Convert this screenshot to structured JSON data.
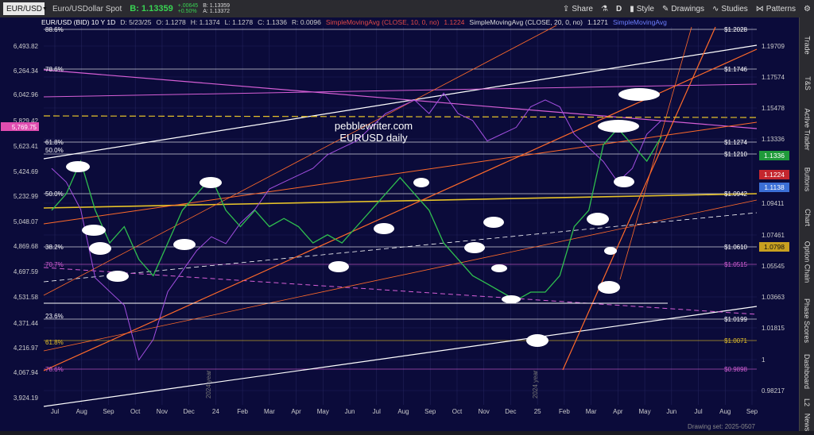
{
  "toolbar": {
    "symbol": "EUR/USD",
    "description": "Euro/USDollar Spot",
    "bid": "B: 1.13359",
    "change_pos": "+.00645",
    "change_pct": "+0.50%",
    "q_b": "B: 1.13359",
    "q_a": "A: 1.13372",
    "share": "Share",
    "style": "Style",
    "drawings": "Drawings",
    "studies": "Studies",
    "patterns": "Patterns",
    "d_label": "D"
  },
  "infobar": {
    "title": "EUR/USD (BID) 10 Y 1D",
    "date": "D: 5/23/25",
    "open": "O: 1.1278",
    "high": "H: 1.1374",
    "low": "L: 1.1278",
    "close": "C: 1.1336",
    "change": "R: 0.0096",
    "sma10": "SimpleMovingAvg (CLOSE, 10, 0, no)",
    "sma10_val": "1.1224",
    "sma20": "SimpleMovingAvg (CLOSE, 20, 0, no)",
    "sma20_val": "1.1271",
    "sma_more": "SimpleMovingAvg"
  },
  "annotations": {
    "watermark1": "pebblewriter.com",
    "watermark2": "EURUSD daily",
    "year_2024_a": "2024 year",
    "year_2024_b": "2024 year"
  },
  "colors": {
    "bg": "#0b0b3a",
    "white_line": "#ffffff",
    "magenta": "#d65fd6",
    "orange": "#ff6a2a",
    "yellow": "#e6c229",
    "green_badge": "#1f9a3a",
    "red_badge": "#c4262e",
    "blue_badge": "#3b6fd6",
    "gold_badge": "#c8a020"
  },
  "side_tabs": [
    "Trade",
    "T&S",
    "Active Trader",
    "Buttons",
    "Chart",
    "Option Chain",
    "Phase Scores",
    "Dashboard",
    "L2",
    "News"
  ],
  "footer": {
    "drawing_set": "Drawing set: 2025-0507"
  },
  "chart_data": {
    "type": "line",
    "title": "EUR/USD (BID) 10 Y 1D",
    "x_ticks": [
      "Jul",
      "Aug",
      "Sep",
      "Oct",
      "Nov",
      "Dec",
      "24",
      "Feb",
      "Mar",
      "Apr",
      "May",
      "Jun",
      "Jul",
      "Aug",
      "Sep",
      "Oct",
      "Nov",
      "Dec",
      "25",
      "Feb",
      "Mar",
      "Apr",
      "May",
      "Jun",
      "Jul",
      "Aug",
      "Sep"
    ],
    "left_axis_ticks": [
      "6,493.82",
      "6,264.34",
      "6,042.96",
      "5,829.42",
      "5,769.75",
      "5,623.41",
      "5,424.69",
      "5,232.99",
      "5,048.07",
      "4,869.68",
      "4,697.59",
      "4,531.58",
      "4,371.44",
      "4,216.97",
      "4,067.94",
      "3,924.19"
    ],
    "right_axis_ticks": [
      "1.19709",
      "1.17574",
      "1.15478",
      "1.13336",
      "1.09411",
      "1.07461",
      "1.05545",
      "1.03663",
      "1.01815",
      "1",
      "0.98217"
    ],
    "fib_labels_left": [
      "88.6%",
      "78.6%",
      "61.8%",
      "50.0%",
      "50.0%",
      "38.2%",
      "70.7%",
      "23.6%",
      "61.8%",
      "78.6%"
    ],
    "fib_labels_right": [
      "$1.2028",
      "$1.1746",
      "$1.1274",
      "$1.1210",
      "$1.0942",
      "$1.0610",
      "$1.0515",
      "$1.0199",
      "$1.0071",
      "$0.9898"
    ],
    "price_badges": [
      {
        "label": "1.1336",
        "color": "green"
      },
      {
        "label": "1.1224",
        "color": "red"
      },
      {
        "label": "1.1138",
        "color": "blue"
      },
      {
        "label": "1.0798",
        "color": "gold"
      }
    ],
    "price_path": [
      1.09,
      1.1,
      1.12,
      1.09,
      1.07,
      1.08,
      1.06,
      1.05,
      1.07,
      1.09,
      1.1,
      1.11,
      1.09,
      1.08,
      1.09,
      1.08,
      1.085,
      1.08,
      1.07,
      1.075,
      1.07,
      1.08,
      1.09,
      1.1,
      1.11,
      1.1,
      1.09,
      1.07,
      1.06,
      1.05,
      1.045,
      1.04,
      1.035,
      1.04,
      1.04,
      1.05,
      1.08,
      1.09,
      1.13,
      1.14,
      1.13,
      1.12,
      1.135
    ],
    "sp_path": [
      5600,
      5500,
      5300,
      4800,
      4700,
      4600,
      4200,
      4350,
      4700,
      4850,
      5000,
      5100,
      5050,
      5200,
      5300,
      5450,
      5500,
      5550,
      5600,
      5700,
      5750,
      5800,
      5900,
      6000,
      6050,
      6100,
      6000,
      6150,
      6000,
      5950,
      5800,
      5850,
      5900,
      6050,
      6100,
      6050,
      5850,
      5750,
      5650,
      5500,
      5600,
      5850,
      5950
    ]
  }
}
